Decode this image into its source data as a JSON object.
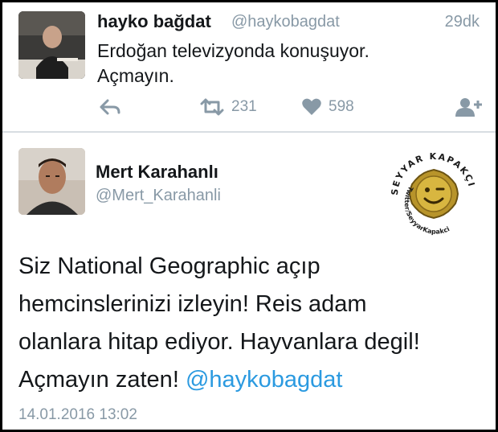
{
  "tweet1": {
    "name": "hayko bağdat",
    "handle": "@haykobagdat",
    "time": "29dk",
    "text_line1": "Erdoğan televizyonda konuşuyor.",
    "text_line2": "Açmayın.",
    "actions": {
      "reply_icon": "reply-icon",
      "retweet_icon": "retweet-icon",
      "retweet_count": "231",
      "like_icon": "heart-icon",
      "like_count": "598",
      "follow_icon": "follow-icon"
    }
  },
  "tweet2": {
    "name": "Mert Karahanlı",
    "handle": "@Mert_Karahanli",
    "text_line1": "Siz National Geographic açıp",
    "text_line2": "hemcinslerinizi izleyin! Reis adam",
    "text_line3": "olanlara hitap ediyor. Hayvanlara degil!",
    "text_line4_prefix": "Açmayın zaten! ",
    "mention": "@haykobagdat",
    "date": "14.01.2016 13:02"
  },
  "badge": {
    "top_text": "SEYYAR KAPAKÇI",
    "bottom_text": "Twitter/SeyyarKapakci"
  },
  "colors": {
    "mention": "#2b9ae0",
    "muted": "#8899a6",
    "text": "#14171a"
  }
}
